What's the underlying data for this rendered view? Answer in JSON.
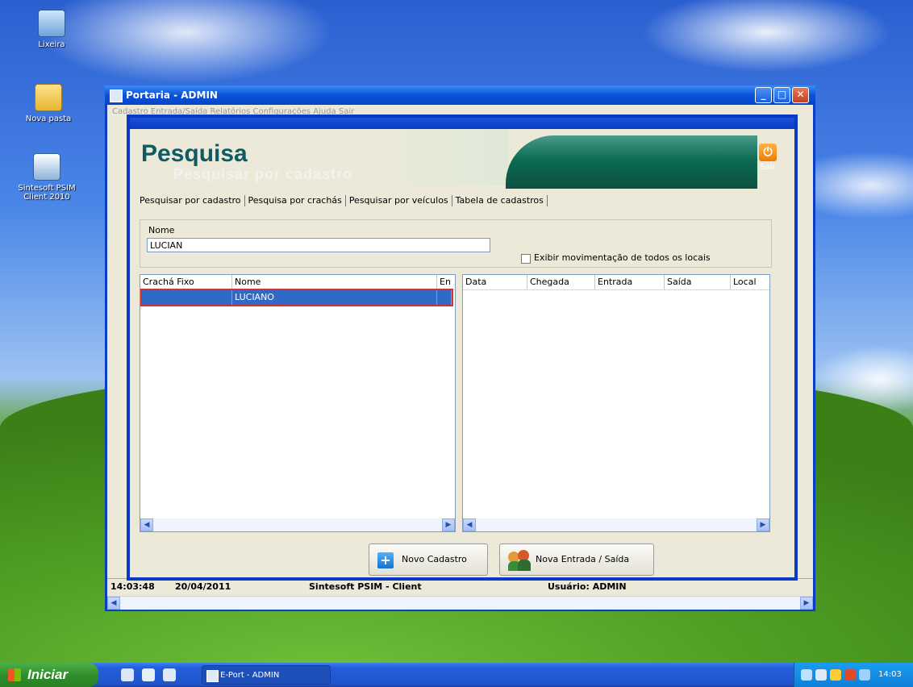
{
  "desktop": {
    "icons": [
      {
        "label": "Lixeira"
      },
      {
        "label": "Nova pasta"
      },
      {
        "label": "Sintesoft PSIM Client 2010"
      }
    ]
  },
  "window": {
    "title": "Portaria - ADMIN",
    "menu_text": "Cadastro  Entrada/Saída  Relatórios  Configurações  Ajuda  Sair"
  },
  "dialog": {
    "title": "Pesquisa",
    "subtitle": "Pesquisar por cadastro",
    "exit_label": "Sair",
    "tabs": [
      {
        "label": "Pesquisar por cadastro"
      },
      {
        "label": "Pesquisa por crachás"
      },
      {
        "label": "Pesquisar por veículos"
      },
      {
        "label": "Tabela de cadastros"
      }
    ],
    "search": {
      "label": "Nome",
      "value": "LUCIAN"
    },
    "checkbox_label": "Exibir movimentação de todos os locais",
    "left_grid": {
      "columns": [
        "Crachá Fixo",
        "Nome",
        "En"
      ],
      "rows": [
        {
          "cracha": "",
          "nome": "LUCIANO",
          "en": ""
        }
      ]
    },
    "right_grid": {
      "columns": [
        "Data",
        "Chegada",
        "Entrada",
        "Saída",
        "Local"
      ]
    },
    "buttons": {
      "novo_cadastro": "Novo Cadastro",
      "nova_entrada": "Nova Entrada / Saída"
    }
  },
  "statusbar": {
    "time": "14:03:48",
    "date": "20/04/2011",
    "app": "Sintesoft PSIM - Client",
    "user": "Usuário: ADMIN"
  },
  "taskbar": {
    "start_label": "Iniciar",
    "task_label": "E-Port - ADMIN",
    "clock": "14:03"
  },
  "colors": {
    "title_blue": "#0a52d9",
    "header_green": "#0d6b53",
    "selection": "#316ac5",
    "selection_outline": "#d83030"
  }
}
